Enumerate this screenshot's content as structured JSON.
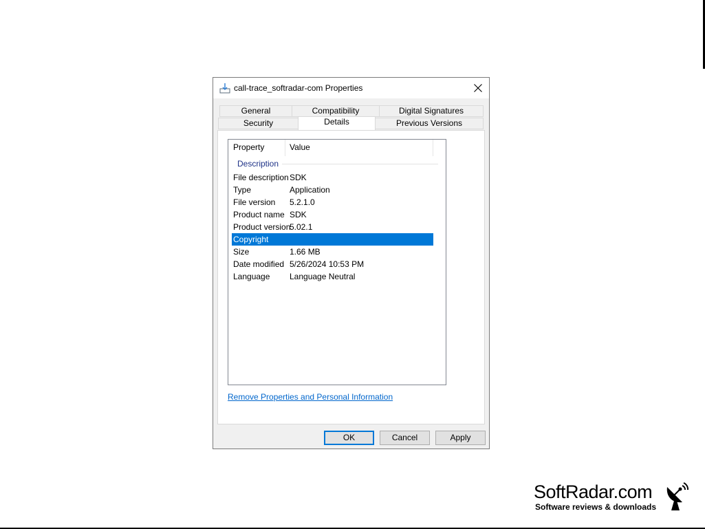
{
  "dialog": {
    "title": "call-trace_softradar-com Properties",
    "tabs_top": [
      {
        "label": "General"
      },
      {
        "label": "Compatibility"
      },
      {
        "label": "Digital Signatures"
      }
    ],
    "tabs_bottom": [
      {
        "label": "Security"
      },
      {
        "label": "Details",
        "active": true
      },
      {
        "label": "Previous Versions"
      }
    ],
    "details": {
      "columns": [
        "Property",
        "Value"
      ],
      "group": "Description",
      "rows": [
        {
          "property": "File description",
          "value": "SDK"
        },
        {
          "property": "Type",
          "value": "Application"
        },
        {
          "property": "File version",
          "value": "5.2.1.0"
        },
        {
          "property": "Product name",
          "value": "SDK"
        },
        {
          "property": "Product version",
          "value": "5.02.1"
        },
        {
          "property": "Copyright",
          "value": "",
          "selected": true
        },
        {
          "property": "Size",
          "value": "1.66 MB"
        },
        {
          "property": "Date modified",
          "value": "5/26/2024 10:53 PM"
        },
        {
          "property": "Language",
          "value": "Language Neutral"
        }
      ]
    },
    "remove_link": "Remove Properties and Personal Information",
    "buttons": {
      "ok": "OK",
      "cancel": "Cancel",
      "apply": "Apply"
    }
  },
  "watermark": {
    "name": "SoftRadar.com",
    "tagline": "Software reviews & downloads",
    "icon": "satellite-dish-icon"
  },
  "colors": {
    "selection": "#0078d7",
    "link": "#0066cc",
    "group_label": "#1e3287"
  }
}
